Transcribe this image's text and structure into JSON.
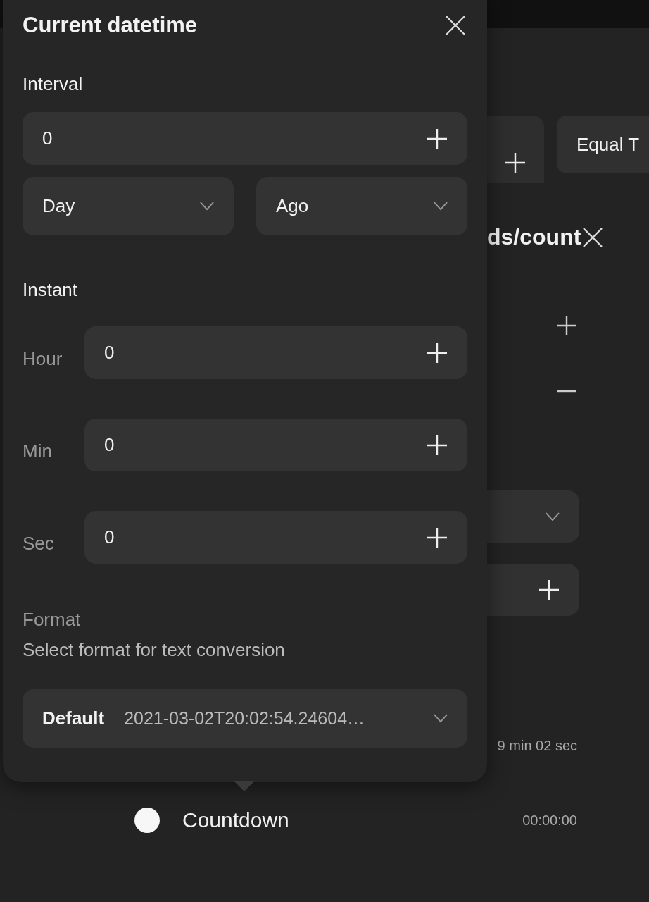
{
  "popover": {
    "title": "Current datetime",
    "interval": {
      "label": "Interval",
      "value": "0",
      "unit": "Day",
      "direction": "Ago"
    },
    "instant": {
      "label": "Instant",
      "fields": [
        {
          "label": "Hour",
          "value": "0"
        },
        {
          "label": "Min",
          "value": "0"
        },
        {
          "label": "Sec",
          "value": "0"
        }
      ]
    },
    "format": {
      "label": "Format",
      "description": "Select format for text conversion",
      "name": "Default",
      "example": "2021-03-02T20:02:54.24604…"
    }
  },
  "background": {
    "button": "Equal T",
    "heading": "ds/count",
    "duration": "9 min 02 sec",
    "rows": [
      {
        "label": "Countdown",
        "value": "00:00:00",
        "selected": false
      }
    ]
  }
}
